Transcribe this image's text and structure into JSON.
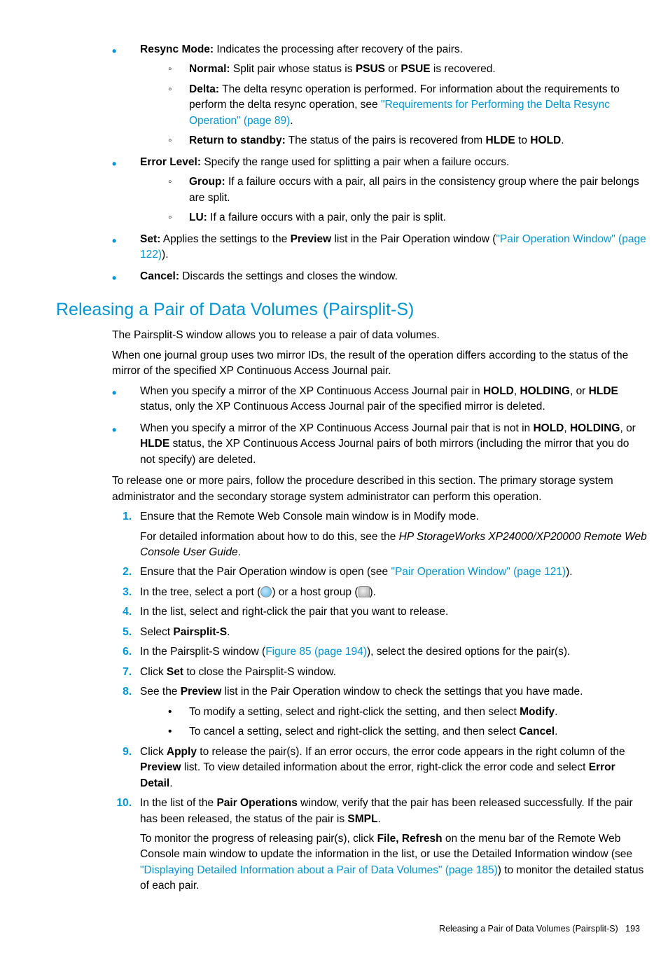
{
  "top_list": {
    "resync_mode": {
      "label": "Resync Mode:",
      "text": " Indicates the processing after recovery of the pairs.",
      "sub": {
        "normal": {
          "label": "Normal:",
          "t1": " Split pair whose status is ",
          "b1": "PSUS",
          "t2": " or ",
          "b2": "PSUE",
          "t3": " is recovered."
        },
        "delta": {
          "label": "Delta:",
          "t1": " The delta resync operation is performed. For information about the requirements to perform the delta resync operation, see ",
          "link": "\"Requirements for Performing the Delta Resync Operation\" (page 89)",
          "t2": "."
        },
        "return": {
          "label": "Return to standby:",
          "t1": " The status of the pairs is recovered from ",
          "b1": "HLDE",
          "t2": " to ",
          "b2": "HOLD",
          "t3": "."
        }
      }
    },
    "error_level": {
      "label": "Error Level:",
      "text": " Specify the range used for splitting a pair when a failure occurs.",
      "sub": {
        "group": {
          "label": "Group:",
          "text": " If a failure occurs with a pair, all pairs in the consistency group where the pair belongs are split."
        },
        "lu": {
          "label": "LU:",
          "text": " If a failure occurs with a pair, only the pair is split."
        }
      }
    },
    "set": {
      "label": "Set:",
      "t1": " Applies the settings to the ",
      "b1": "Preview",
      "t2": " list in the Pair Operation window (",
      "link": "\"Pair Operation Window\" (page 122)",
      "t3": ")."
    },
    "cancel": {
      "label": "Cancel:",
      "text": " Discards the settings and closes the window."
    }
  },
  "section": {
    "title": "Releasing a Pair of Data Volumes (Pairsplit-S)",
    "p1": "The Pairsplit-S window allows you to release a pair of data volumes.",
    "p2": "When one journal group uses two mirror IDs, the result of the operation differs according to the status of the mirror of the specified XP Continuous Access Journal pair.",
    "bullets": {
      "b1": {
        "t1": "When you specify a mirror of the XP Continuous Access Journal pair in ",
        "s1": "HOLD",
        "c1": ", ",
        "s2": "HOLDING",
        "c2": ", or ",
        "s3": "HLDE",
        "t2": " status, only the XP Continuous Access Journal pair of the specified mirror is deleted."
      },
      "b2": {
        "t1": "When you specify a mirror of the XP Continuous Access Journal pair that is not in ",
        "s1": "HOLD",
        "c1": ", ",
        "s2": "HOLDING",
        "c2": ", or ",
        "s3": "HLDE",
        "t2": " status, the XP Continuous Access Journal pairs of both mirrors (including the mirror that you do not specify) are deleted."
      }
    },
    "p3": "To release one or more pairs, follow the procedure described in this section. The primary storage system administrator and the secondary storage system administrator can perform this operation."
  },
  "steps": {
    "s1": {
      "t1": "Ensure that the Remote Web Console main window is in Modify mode.",
      "p": {
        "t1": "For detailed information about how to do this, see the ",
        "i1": "HP StorageWorks XP24000/XP20000 Remote Web Console User Guide",
        "t2": "."
      }
    },
    "s2": {
      "t1": "Ensure that the Pair Operation window is open (see ",
      "link": "\"Pair Operation Window\" (page 121)",
      "t2": ")."
    },
    "s3": {
      "t1": "In the tree, select a port (",
      "t2": ") or a host group (",
      "t3": ")."
    },
    "s4": {
      "t1": "In the list, select and right-click the pair that you want to release."
    },
    "s5": {
      "t1": "Select ",
      "b1": "Pairsplit-S",
      "t2": "."
    },
    "s6": {
      "t1": "In the Pairsplit-S window (",
      "link": "Figure 85 (page 194)",
      "t2": "), select the desired options for the pair(s)."
    },
    "s7": {
      "t1": "Click ",
      "b1": "Set",
      "t2": " to close the Pairsplit-S window."
    },
    "s8": {
      "t1": "See the ",
      "b1": "Preview",
      "t2": " list in the Pair Operation window to check the settings that you have made.",
      "sub": {
        "a": {
          "t1": "To modify a setting, select and right-click the setting, and then select ",
          "b1": "Modify",
          "t2": "."
        },
        "b": {
          "t1": "To cancel a setting, select and right-click the setting, and then select ",
          "b1": "Cancel",
          "t2": "."
        }
      }
    },
    "s9": {
      "t1": "Click ",
      "b1": "Apply",
      "t2": " to release the pair(s). If an error occurs, the error code appears in the right column of the ",
      "b2": "Preview",
      "t3": " list. To view detailed information about the error, right-click the error code and select ",
      "b3": "Error Detail",
      "t4": "."
    },
    "s10": {
      "t1": "In the list of the ",
      "b1": "Pair Operations",
      "t2": " window, verify that the pair has been released successfully. If the pair has been released, the status of the pair is ",
      "b2": "SMPL",
      "t3": ".",
      "p": {
        "t1": "To monitor the progress of releasing pair(s), click ",
        "b1": "File, Refresh",
        "t2": " on the menu bar of the Remote Web Console main window to update the information in the list, or use the Detailed Information window (see ",
        "link": "\"Displaying Detailed Information about a Pair of Data Volumes\" (page 185)",
        "t3": ") to monitor the detailed status of each pair."
      }
    }
  },
  "footer": {
    "title": "Releasing a Pair of Data Volumes (Pairsplit-S)",
    "page": "193"
  }
}
